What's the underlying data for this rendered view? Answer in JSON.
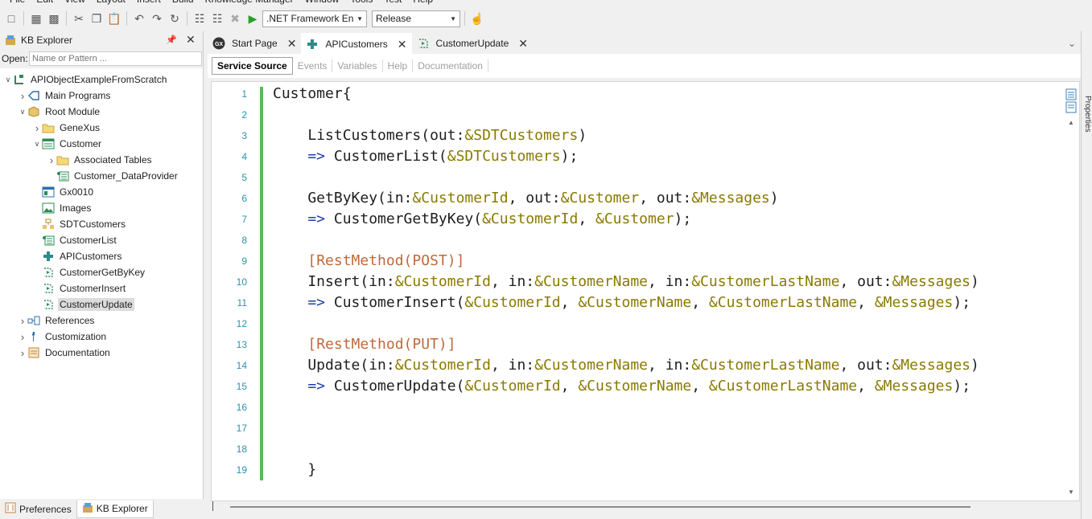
{
  "menu": [
    "File",
    "Edit",
    "View",
    "Layout",
    "Insert",
    "Build",
    "Knowledge Manager",
    "Window",
    "Tools",
    "Test",
    "Help"
  ],
  "toolbar": {
    "framework": ".NET Framework En",
    "configuration": "Release"
  },
  "kb_explorer": {
    "title": "KB Explorer",
    "open_label": "Open:",
    "open_placeholder": "Name or Pattern ...",
    "tree": [
      {
        "label": "APIObjectExampleFromScratch",
        "icon": "kb-root-icon",
        "level": 0,
        "expander": "expanded"
      },
      {
        "label": "Main Programs",
        "icon": "main-programs-icon",
        "level": 1,
        "expander": "collapsed"
      },
      {
        "label": "Root Module",
        "icon": "module-icon",
        "level": 1,
        "expander": "expanded"
      },
      {
        "label": "GeneXus",
        "icon": "folder-icon",
        "level": 2,
        "expander": "collapsed"
      },
      {
        "label": "Customer",
        "icon": "transaction-icon",
        "level": 2,
        "expander": "expanded"
      },
      {
        "label": "Associated Tables",
        "icon": "folder-icon",
        "level": 3,
        "expander": "collapsed"
      },
      {
        "label": "Customer_DataProvider",
        "icon": "dataprovider-icon",
        "level": 3,
        "expander": "none"
      },
      {
        "label": "Gx0010",
        "icon": "webpanel-icon",
        "level": 2,
        "expander": "none"
      },
      {
        "label": "Images",
        "icon": "images-icon",
        "level": 2,
        "expander": "none"
      },
      {
        "label": "SDTCustomers",
        "icon": "sdt-icon",
        "level": 2,
        "expander": "none"
      },
      {
        "label": "CustomerList",
        "icon": "dataprovider-icon",
        "level": 2,
        "expander": "none"
      },
      {
        "label": "APICustomers",
        "icon": "api-icon",
        "level": 2,
        "expander": "none"
      },
      {
        "label": "CustomerGetByKey",
        "icon": "procedure-icon",
        "level": 2,
        "expander": "none"
      },
      {
        "label": "CustomerInsert",
        "icon": "procedure-icon",
        "level": 2,
        "expander": "none"
      },
      {
        "label": "CustomerUpdate",
        "icon": "procedure-icon",
        "level": 2,
        "expander": "none",
        "selected": true
      },
      {
        "label": "References",
        "icon": "references-icon",
        "level": 1,
        "expander": "collapsed"
      },
      {
        "label": "Customization",
        "icon": "customization-icon",
        "level": 1,
        "expander": "collapsed"
      },
      {
        "label": "Documentation",
        "icon": "documentation-icon",
        "level": 1,
        "expander": "collapsed"
      }
    ]
  },
  "bottom_tabs": [
    {
      "label": "Preferences",
      "icon": "preferences-icon"
    },
    {
      "label": "KB Explorer",
      "icon": "kb-explorer-icon",
      "active": true
    }
  ],
  "doc_tabs": [
    {
      "label": "Start Page",
      "icon": "gx-icon"
    },
    {
      "label": "APICustomers",
      "icon": "api-icon",
      "active": true
    },
    {
      "label": "CustomerUpdate",
      "icon": "procedure-icon"
    }
  ],
  "sub_tabs": [
    {
      "label": "Service Source",
      "active": true
    },
    {
      "label": "Events"
    },
    {
      "label": "Variables"
    },
    {
      "label": "Help"
    },
    {
      "label": "Documentation"
    }
  ],
  "side_strip_label": "Properties",
  "code_lines": [
    {
      "n": "1",
      "tokens": [
        {
          "t": "Customer{",
          "c": "plain"
        }
      ]
    },
    {
      "n": "2",
      "tokens": []
    },
    {
      "n": "3",
      "tokens": [
        {
          "t": "    ListCustomers(out:",
          "c": "plain"
        },
        {
          "t": "&SDTCustomers",
          "c": "var"
        },
        {
          "t": ")",
          "c": "plain"
        }
      ]
    },
    {
      "n": "4",
      "tokens": [
        {
          "t": "    => ",
          "c": "arrow"
        },
        {
          "t": "CustomerList(",
          "c": "plain"
        },
        {
          "t": "&SDTCustomers",
          "c": "var"
        },
        {
          "t": ");",
          "c": "plain"
        }
      ]
    },
    {
      "n": "5",
      "tokens": []
    },
    {
      "n": "6",
      "tokens": [
        {
          "t": "    GetByKey(in:",
          "c": "plain"
        },
        {
          "t": "&CustomerId",
          "c": "var"
        },
        {
          "t": ", out:",
          "c": "plain"
        },
        {
          "t": "&Customer",
          "c": "var"
        },
        {
          "t": ", out:",
          "c": "plain"
        },
        {
          "t": "&Messages",
          "c": "var"
        },
        {
          "t": ")",
          "c": "plain"
        }
      ]
    },
    {
      "n": "7",
      "tokens": [
        {
          "t": "    => ",
          "c": "arrow"
        },
        {
          "t": "CustomerGetByKey(",
          "c": "plain"
        },
        {
          "t": "&CustomerId",
          "c": "var"
        },
        {
          "t": ", ",
          "c": "plain"
        },
        {
          "t": "&Customer",
          "c": "var"
        },
        {
          "t": ");",
          "c": "plain"
        }
      ]
    },
    {
      "n": "8",
      "tokens": []
    },
    {
      "n": "9",
      "tokens": [
        {
          "t": "    [",
          "c": "attr"
        },
        {
          "t": "RestMethod(POST)",
          "c": "attr"
        },
        {
          "t": "]",
          "c": "attr"
        }
      ]
    },
    {
      "n": "10",
      "tokens": [
        {
          "t": "    Insert(in:",
          "c": "plain"
        },
        {
          "t": "&CustomerId",
          "c": "var"
        },
        {
          "t": ", in:",
          "c": "plain"
        },
        {
          "t": "&CustomerName",
          "c": "var"
        },
        {
          "t": ", in:",
          "c": "plain"
        },
        {
          "t": "&CustomerLastName",
          "c": "var"
        },
        {
          "t": ", out:",
          "c": "plain"
        },
        {
          "t": "&Messages",
          "c": "var"
        },
        {
          "t": ")",
          "c": "plain"
        }
      ]
    },
    {
      "n": "11",
      "tokens": [
        {
          "t": "    => ",
          "c": "arrow"
        },
        {
          "t": "CustomerInsert(",
          "c": "plain"
        },
        {
          "t": "&CustomerId",
          "c": "var"
        },
        {
          "t": ", ",
          "c": "plain"
        },
        {
          "t": "&CustomerName",
          "c": "var"
        },
        {
          "t": ", ",
          "c": "plain"
        },
        {
          "t": "&CustomerLastName",
          "c": "var"
        },
        {
          "t": ", ",
          "c": "plain"
        },
        {
          "t": "&Messages",
          "c": "var"
        },
        {
          "t": ");",
          "c": "plain"
        }
      ]
    },
    {
      "n": "12",
      "tokens": []
    },
    {
      "n": "13",
      "tokens": [
        {
          "t": "    [",
          "c": "attr"
        },
        {
          "t": "RestMethod(PUT)",
          "c": "attr"
        },
        {
          "t": "]",
          "c": "attr"
        }
      ]
    },
    {
      "n": "14",
      "tokens": [
        {
          "t": "    Update(in:",
          "c": "plain"
        },
        {
          "t": "&CustomerId",
          "c": "var"
        },
        {
          "t": ", in:",
          "c": "plain"
        },
        {
          "t": "&CustomerName",
          "c": "var"
        },
        {
          "t": ", in:",
          "c": "plain"
        },
        {
          "t": "&CustomerLastName",
          "c": "var"
        },
        {
          "t": ", out:",
          "c": "plain"
        },
        {
          "t": "&Messages",
          "c": "var"
        },
        {
          "t": ")",
          "c": "plain"
        }
      ]
    },
    {
      "n": "15",
      "tokens": [
        {
          "t": "    => ",
          "c": "arrow"
        },
        {
          "t": "CustomerUpdate(",
          "c": "plain"
        },
        {
          "t": "&CustomerId",
          "c": "var"
        },
        {
          "t": ", ",
          "c": "plain"
        },
        {
          "t": "&CustomerName",
          "c": "var"
        },
        {
          "t": ", ",
          "c": "plain"
        },
        {
          "t": "&CustomerLastName",
          "c": "var"
        },
        {
          "t": ", ",
          "c": "plain"
        },
        {
          "t": "&Messages",
          "c": "var"
        },
        {
          "t": ");",
          "c": "plain"
        }
      ]
    },
    {
      "n": "16",
      "tokens": []
    },
    {
      "n": "17",
      "tokens": []
    },
    {
      "n": "18",
      "tokens": []
    },
    {
      "n": "19",
      "tokens": [
        {
          "t": "    }",
          "c": "plain"
        }
      ]
    }
  ],
  "colors": {
    "variable": "#8a7a00",
    "attribute": "#c0693a",
    "arrow": "#1f3ea8",
    "line_number": "#2b91af",
    "change_bar": "#5cb85c"
  }
}
